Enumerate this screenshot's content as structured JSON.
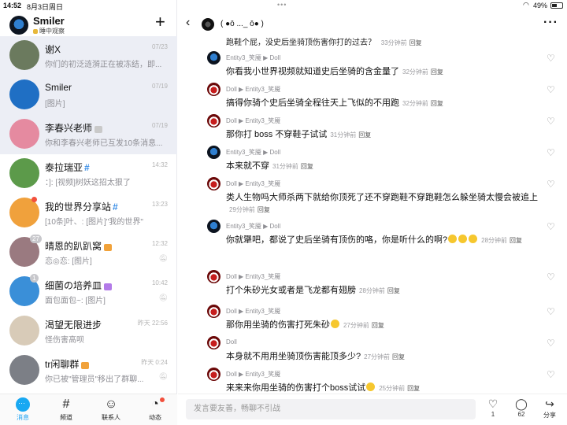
{
  "status": {
    "time": "14:52",
    "date": "8月3日周日",
    "battery": "49%"
  },
  "profile": {
    "name": "Smiler",
    "status": "睡中观察"
  },
  "chats": [
    {
      "title": "谢X",
      "time": "07/23",
      "preview": "你们的初泛涟漪正在被冻结，即...",
      "avatar_color": "#6b7a5e",
      "tag": "",
      "tag_color": "",
      "hash": false,
      "badge": "",
      "red_dot": false,
      "muted": false,
      "selected": true
    },
    {
      "title": "Smiler",
      "time": "07/19",
      "preview": "[图片]",
      "avatar_color": "#1f6fc4",
      "tag": "",
      "tag_color": "",
      "hash": false,
      "badge": "",
      "red_dot": false,
      "muted": false,
      "selected": true
    },
    {
      "title": "李春兴老师",
      "time": "07/19",
      "preview": "你和李春兴老师已互发10条消息...",
      "avatar_color": "#e58aa0",
      "tag": "",
      "tag_color": "#c9c9c9",
      "hash": false,
      "badge": "",
      "red_dot": false,
      "muted": false,
      "selected": true
    },
    {
      "title": "泰拉瑞亚",
      "time": "14:32",
      "preview": "：]: [视频]树妖这招太狠了",
      "avatar_color": "#5c9a4a",
      "tag": "",
      "tag_color": "",
      "hash": true,
      "badge": "",
      "red_dot": false,
      "muted": false,
      "selected": false
    },
    {
      "title": "我的世界分享站",
      "time": "13:23",
      "preview": "[10条]叶、: [图片]\"我的世界\"",
      "avatar_color": "#f0a13c",
      "tag": "",
      "tag_color": "",
      "hash": true,
      "badge": "",
      "red_dot": true,
      "muted": false,
      "selected": false
    },
    {
      "title": "晴恩的趴趴窝",
      "time": "12:32",
      "preview": "恋◎恋: [图片]",
      "avatar_color": "#9a7a80",
      "tag": "",
      "tag_color": "#f1a23a",
      "hash": false,
      "badge": "27",
      "red_dot": false,
      "muted": true,
      "selected": false
    },
    {
      "title": "细菌の培养皿",
      "time": "10:42",
      "preview": "面包面包~: [图片]",
      "avatar_color": "#3a8fd8",
      "tag": "",
      "tag_color": "#b37be8",
      "hash": false,
      "badge": "1",
      "red_dot": false,
      "muted": true,
      "selected": false
    },
    {
      "title": "渴望无限进步",
      "time": "昨天 22:56",
      "preview": "怪伤害高呗",
      "avatar_color": "#d8cbb8",
      "tag": "",
      "tag_color": "",
      "hash": false,
      "badge": "",
      "red_dot": false,
      "muted": false,
      "selected": false
    },
    {
      "title": "tr闲聊群",
      "time": "昨天 0:24",
      "preview": "你已被\"管理员\"移出了群聊...",
      "avatar_color": "#7c7f86",
      "tag": "",
      "tag_color": "#f1a23a",
      "hash": false,
      "badge": "",
      "red_dot": false,
      "muted": true,
      "selected": false
    }
  ],
  "tabs": [
    {
      "label": "消息",
      "icon": "message-icon",
      "active": true
    },
    {
      "label": "频道",
      "icon": "channel-icon",
      "active": false
    },
    {
      "label": "联系人",
      "icon": "contacts-icon",
      "active": false
    },
    {
      "label": "动态",
      "icon": "moments-icon",
      "active": false
    }
  ],
  "thread": {
    "title": "( ●ō ..._ ō● )"
  },
  "top_comment": {
    "text": "跑鞋个屁，没史后坐骑顶伤害你打的过去？",
    "time": "33分钟前",
    "reply": "回复"
  },
  "comments": [
    {
      "author": "Entity3_笑魇 ▶ Doll",
      "avatar": "blue",
      "text": "你看我小世界视频就知道史后坐骑的含金量了",
      "time": "32分钟前",
      "reply": "回复",
      "emojis": 0
    },
    {
      "author": "Doll ▶ Entity3_笑魇",
      "avatar": "red",
      "text": "搞得你骑个史后坐骑全程往天上飞似的不用跑",
      "time": "32分钟前",
      "reply": "回复",
      "emojis": 0
    },
    {
      "author": "Doll ▶ Entity3_笑魇",
      "avatar": "red",
      "text": "那你打 boss 不穿鞋子试试",
      "time": "31分钟前",
      "reply": "回复",
      "emojis": 0
    },
    {
      "author": "Entity3_笑魇 ▶ Doll",
      "avatar": "blue",
      "text": "本来就不穿",
      "time": "31分钟前",
      "reply": "回复",
      "emojis": 0
    },
    {
      "author": "Doll ▶ Entity3_笑魇",
      "avatar": "red",
      "text": "类人生物吗大师杀两下就给你顶死了还不穿跑鞋不穿跑鞋怎么躲坐骑太慢会被追上",
      "time": "29分钟前",
      "reply": "回复",
      "emojis": 0
    },
    {
      "author": "Entity3_笑魇 ▶ Doll",
      "avatar": "blue",
      "text": "你就犟吧，都说了史后坐骑有顶伤的咯，你是听什么的啊?",
      "time": "28分钟前",
      "reply": "回复",
      "emojis": 3
    },
    {
      "author": "Doll ▶ Entity3_笑魇",
      "avatar": "red",
      "text": "打个朱砂光女或者是飞龙都有翅膀",
      "time": "28分钟前",
      "reply": "回复",
      "emojis": 0
    },
    {
      "author": "Doll ▶ Entity3_笑魇",
      "avatar": "red",
      "text": "那你用坐骑的伤害打死朱砂",
      "time": "27分钟前",
      "reply": "回复",
      "emojis": 1
    },
    {
      "author": "Doll",
      "avatar": "red",
      "text": "本身就不用用坐骑顶伤害能顶多少?",
      "time": "27分钟前",
      "reply": "回复",
      "emojis": 0
    },
    {
      "author": "Doll ▶ Entity3_笑魇",
      "avatar": "red",
      "text": "来来来你用坐骑的伤害打个boss试试",
      "time": "25分钟前",
      "reply": "回复",
      "emojis": 1
    }
  ],
  "input": {
    "placeholder": "发言要友善，畅聊不引战"
  },
  "actions": [
    {
      "icon": "heart-icon",
      "label": "1"
    },
    {
      "icon": "comment-icon",
      "label": "62"
    },
    {
      "icon": "share-icon",
      "label": "分享"
    }
  ]
}
